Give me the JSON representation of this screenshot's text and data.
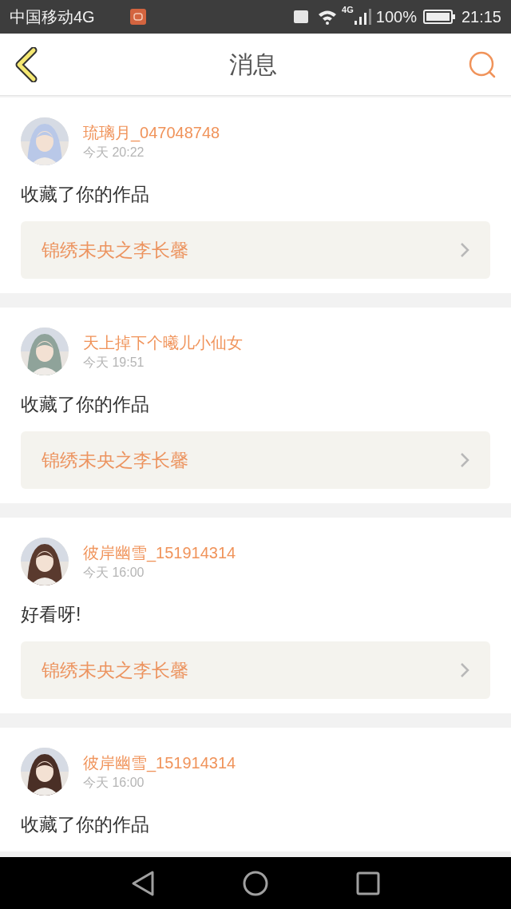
{
  "status_bar": {
    "carrier": "中国移动4G",
    "network": "4G",
    "battery": "100%",
    "time": "21:15"
  },
  "header": {
    "title": "消息"
  },
  "messages": [
    {
      "user": "琉璃月_047048748",
      "time": "今天 20:22",
      "text": "收藏了你的作品",
      "work": "锦绣未央之李长馨"
    },
    {
      "user": "天上掉下个曦儿小仙女",
      "time": "今天 19:51",
      "text": "收藏了你的作品",
      "work": "锦绣未央之李长馨"
    },
    {
      "user": "彼岸幽雪_151914314",
      "time": "今天 16:00",
      "text": "好看呀!",
      "work": "锦绣未央之李长馨"
    },
    {
      "user": "彼岸幽雪_151914314",
      "time": "今天 16:00",
      "text": "收藏了你的作品"
    }
  ]
}
